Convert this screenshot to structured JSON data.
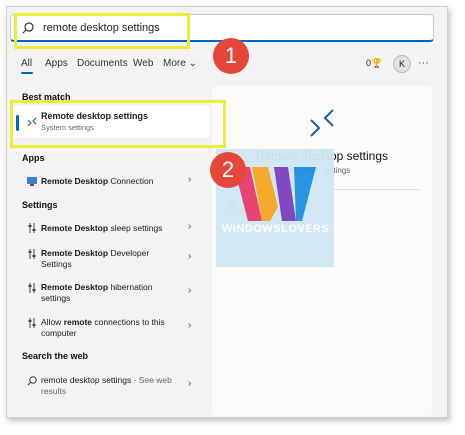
{
  "search": {
    "value": "remote desktop settings"
  },
  "tabs": {
    "all": "All",
    "apps": "Apps",
    "documents": "Documents",
    "web": "Web",
    "more": "More"
  },
  "header_right": {
    "points": "0",
    "avatar_initial": "K"
  },
  "callouts": {
    "one": "1",
    "two": "2"
  },
  "left_panel": {
    "best_match_header": "Best match",
    "best_match": {
      "title": "Remote desktop settings",
      "subtitle": "System settings"
    },
    "apps_header": "Apps",
    "apps": [
      {
        "bold": "Remote Desktop",
        "rest": " Connection"
      }
    ],
    "settings_header": "Settings",
    "settings": [
      {
        "bold": "Remote Desktop",
        "rest": " sleep settings"
      },
      {
        "bold": "Remote Desktop",
        "rest": " Developer Settings"
      },
      {
        "bold": "Remote Desktop",
        "rest": " hibernation settings"
      },
      {
        "pre": "Allow ",
        "bold": "remote",
        "rest": " connections to this computer"
      }
    ],
    "web_header": "Search the web",
    "web": [
      {
        "bold": "remote desktop settings",
        "rest": " - See web results"
      }
    ]
  },
  "right_panel": {
    "title": "Remote desktop settings",
    "subtitle": "System settings"
  },
  "watermark": {
    "text": "WINDOWSLOVERS"
  },
  "colors": {
    "accent": "#0067c0",
    "callout_border": "#e9ed3b",
    "badge": "#e5473b"
  }
}
